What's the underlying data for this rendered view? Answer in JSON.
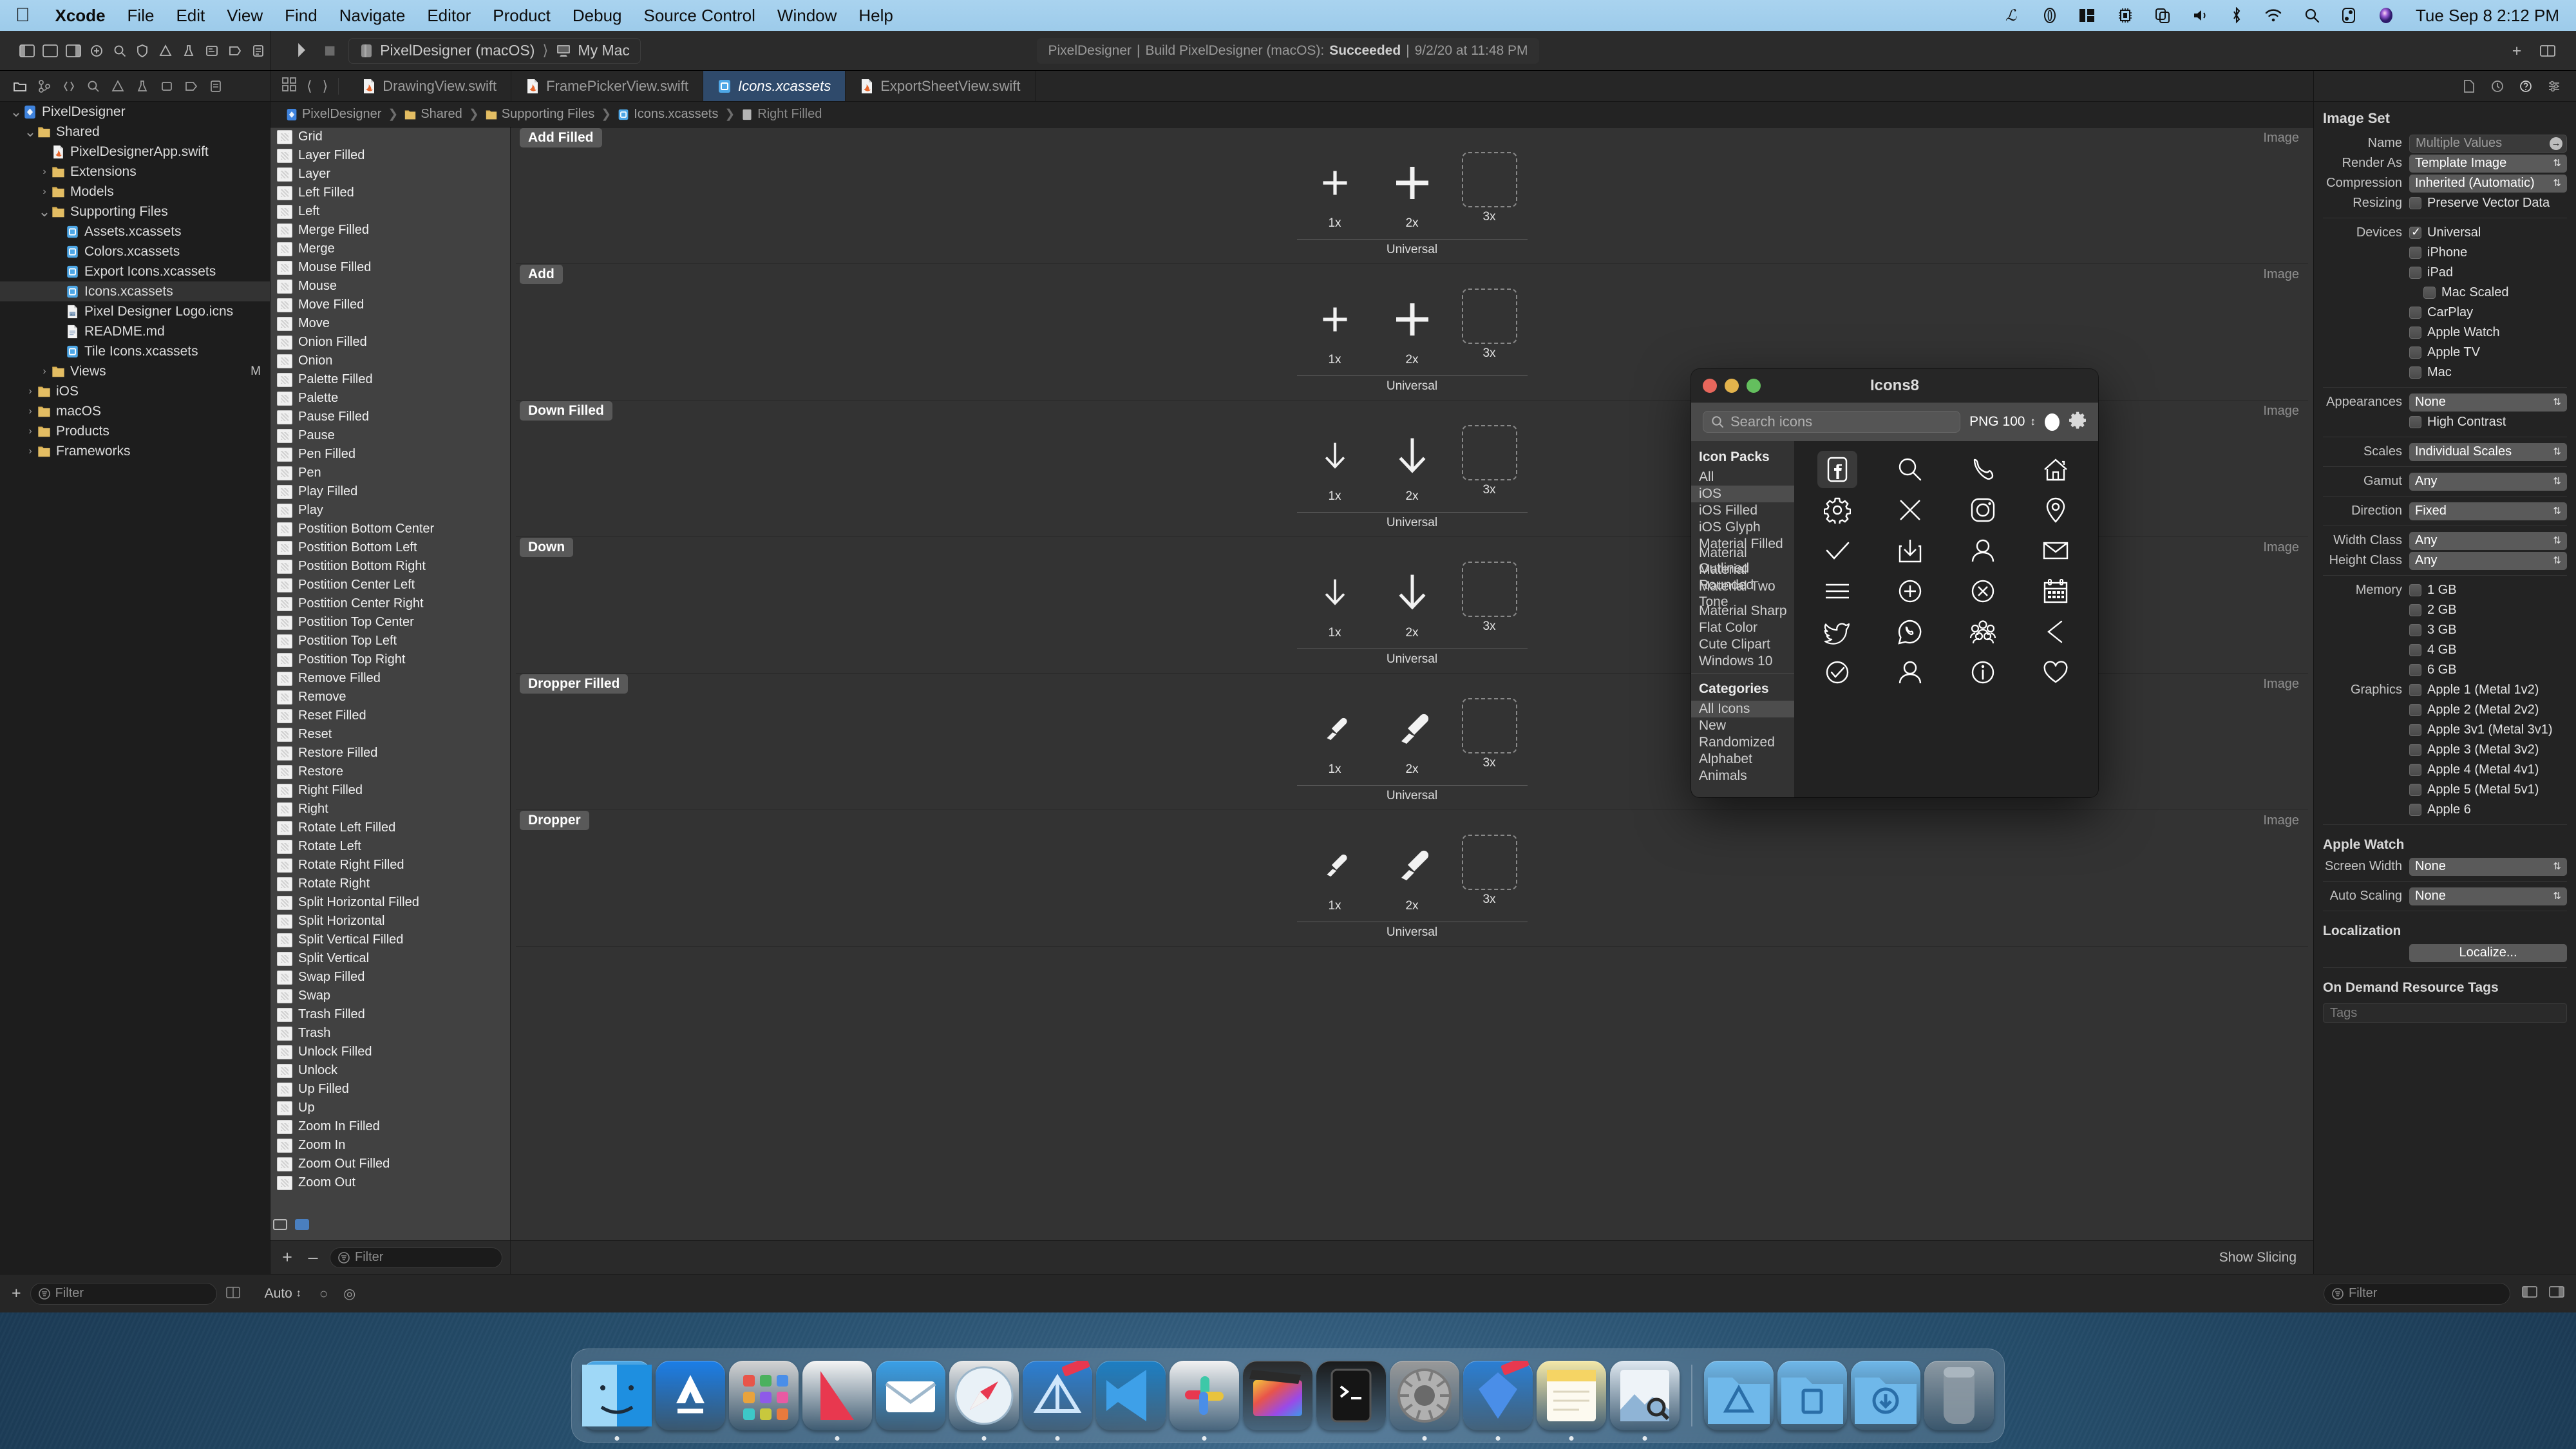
{
  "menubar": {
    "apple": "apple-logo",
    "items": [
      "Xcode",
      "File",
      "Edit",
      "View",
      "Find",
      "Navigate",
      "Editor",
      "Product",
      "Debug",
      "Source Control",
      "Window",
      "Help"
    ],
    "status_icons": [
      "grammarly-icon",
      "capsule-icon",
      "sidebar-icon",
      "cpu-icon",
      "copy-icon",
      "volume-icon",
      "bluetooth-icon",
      "wifi-icon",
      "search-icon",
      "control-center-icon",
      "siri-icon"
    ],
    "clock": "Tue Sep 8  2:12 PM"
  },
  "toolbar": {
    "scheme_project": "PixelDesigner (macOS)",
    "scheme_device": "My Mac",
    "activity": {
      "project": "PixelDesigner",
      "action": "Build PixelDesigner (macOS):",
      "result": "Succeeded",
      "timestamp": "9/2/20 at 11:48 PM"
    }
  },
  "tabs": [
    {
      "label": "DrawingView.swift",
      "icon": "swift-file-icon",
      "active": false
    },
    {
      "label": "FramePickerView.swift",
      "icon": "swift-file-icon",
      "active": false
    },
    {
      "label": "Icons.xcassets",
      "icon": "xcassets-icon",
      "active": true
    },
    {
      "label": "ExportSheetView.swift",
      "icon": "swift-file-icon",
      "active": false
    }
  ],
  "breadcrumb": [
    {
      "label": "PixelDesigner",
      "icon": "project-icon"
    },
    {
      "label": "Shared",
      "icon": "folder-icon"
    },
    {
      "label": "Supporting Files",
      "icon": "folder-icon"
    },
    {
      "label": "Icons.xcassets",
      "icon": "xcassets-icon"
    },
    {
      "label": "Right Filled",
      "icon": "imageset-icon"
    }
  ],
  "navigator": {
    "items": [
      {
        "label": "PixelDesigner",
        "indent": 0,
        "twisty": "down",
        "icon": "project-icon",
        "selected": false,
        "modified": ""
      },
      {
        "label": "Shared",
        "indent": 1,
        "twisty": "down",
        "icon": "folder-icon",
        "selected": false,
        "modified": ""
      },
      {
        "label": "PixelDesignerApp.swift",
        "indent": 2,
        "twisty": "",
        "icon": "swift-file-icon",
        "selected": false,
        "modified": ""
      },
      {
        "label": "Extensions",
        "indent": 2,
        "twisty": "right",
        "icon": "folder-icon",
        "selected": false,
        "modified": ""
      },
      {
        "label": "Models",
        "indent": 2,
        "twisty": "right",
        "icon": "folder-icon",
        "selected": false,
        "modified": ""
      },
      {
        "label": "Supporting Files",
        "indent": 2,
        "twisty": "down",
        "icon": "folder-icon",
        "selected": false,
        "modified": ""
      },
      {
        "label": "Assets.xcassets",
        "indent": 3,
        "twisty": "",
        "icon": "xcassets-icon",
        "selected": false,
        "modified": ""
      },
      {
        "label": "Colors.xcassets",
        "indent": 3,
        "twisty": "",
        "icon": "xcassets-icon",
        "selected": false,
        "modified": ""
      },
      {
        "label": "Export Icons.xcassets",
        "indent": 3,
        "twisty": "",
        "icon": "xcassets-icon",
        "selected": false,
        "modified": ""
      },
      {
        "label": "Icons.xcassets",
        "indent": 3,
        "twisty": "",
        "icon": "xcassets-icon",
        "selected": true,
        "modified": ""
      },
      {
        "label": "Pixel Designer Logo.icns",
        "indent": 3,
        "twisty": "",
        "icon": "icns-icon",
        "selected": false,
        "modified": ""
      },
      {
        "label": "README.md",
        "indent": 3,
        "twisty": "",
        "icon": "markdown-icon",
        "selected": false,
        "modified": ""
      },
      {
        "label": "Tile Icons.xcassets",
        "indent": 3,
        "twisty": "",
        "icon": "xcassets-icon",
        "selected": false,
        "modified": ""
      },
      {
        "label": "Views",
        "indent": 2,
        "twisty": "right",
        "icon": "folder-icon",
        "selected": false,
        "modified": "M"
      },
      {
        "label": "iOS",
        "indent": 1,
        "twisty": "right",
        "icon": "folder-icon",
        "selected": false,
        "modified": ""
      },
      {
        "label": "macOS",
        "indent": 1,
        "twisty": "right",
        "icon": "folder-icon",
        "selected": false,
        "modified": ""
      },
      {
        "label": "Products",
        "indent": 1,
        "twisty": "right",
        "icon": "folder-icon",
        "selected": false,
        "modified": ""
      },
      {
        "label": "Frameworks",
        "indent": 1,
        "twisty": "right",
        "icon": "folder-icon",
        "selected": false,
        "modified": ""
      }
    ],
    "filter_placeholder": "Filter"
  },
  "asset_list": {
    "items": [
      "Grid",
      "Layer Filled",
      "Layer",
      "Left Filled",
      "Left",
      "Merge Filled",
      "Merge",
      "Mouse Filled",
      "Mouse",
      "Move Filled",
      "Move",
      "Onion Filled",
      "Onion",
      "Palette Filled",
      "Palette",
      "Pause Filled",
      "Pause",
      "Pen Filled",
      "Pen",
      "Play Filled",
      "Play",
      "Postition Bottom Center",
      "Postition Bottom Left",
      "Postition Bottom Right",
      "Postition Center Left",
      "Postition Center Right",
      "Postition Top Center",
      "Postition Top Left",
      "Postition Top Right",
      "Remove Filled",
      "Remove",
      "Reset Filled",
      "Reset",
      "Restore Filled",
      "Restore",
      "Right Filled",
      "Right",
      "Rotate Left Filled",
      "Rotate Left",
      "Rotate Right Filled",
      "Rotate Right",
      "Split Horizontal Filled",
      "Split Horizontal",
      "Split Vertical Filled",
      "Split Vertical",
      "Swap Filled",
      "Swap",
      "Trash Filled",
      "Trash",
      "Unlock Filled",
      "Unlock",
      "Up Filled",
      "Up",
      "Zoom In Filled",
      "Zoom In",
      "Zoom Out Filled",
      "Zoom Out"
    ],
    "add_button": "+",
    "remove_button": "–",
    "filter_placeholder": "Filter"
  },
  "editor": {
    "slot_labels": [
      "1x",
      "2x",
      "3x"
    ],
    "footer_label": "Universal",
    "type_label": "Image",
    "show_slicing": "Show Slicing",
    "assets": [
      {
        "name": "Add Filled",
        "slots": [
          "plus-small",
          "plus-large",
          "empty"
        ]
      },
      {
        "name": "Add",
        "slots": [
          "plus-small",
          "plus-large",
          "empty"
        ]
      },
      {
        "name": "Down Filled",
        "slots": [
          "arrow-down-small",
          "arrow-down-large",
          "empty"
        ]
      },
      {
        "name": "Down",
        "slots": [
          "arrow-down-small",
          "arrow-down-large",
          "empty"
        ]
      },
      {
        "name": "Dropper Filled",
        "slots": [
          "dropper-small",
          "dropper-large",
          "empty"
        ]
      },
      {
        "name": "Dropper",
        "slots": [
          "dropper-small",
          "dropper-large",
          "empty"
        ]
      }
    ]
  },
  "inspector": {
    "title": "Image Set",
    "name_label": "Name",
    "name_value": "Multiple Values",
    "render_as_label": "Render As",
    "render_as_value": "Template Image",
    "compression_label": "Compression",
    "compression_value": "Inherited (Automatic)",
    "resizing_label": "Resizing",
    "resizing_option": "Preserve Vector Data",
    "devices_label": "Devices",
    "devices": [
      {
        "label": "Universal",
        "checked": true,
        "indent": 0
      },
      {
        "label": "iPhone",
        "checked": false,
        "indent": 0
      },
      {
        "label": "iPad",
        "checked": false,
        "indent": 0
      },
      {
        "label": "Mac Scaled",
        "checked": false,
        "indent": 1
      },
      {
        "label": "CarPlay",
        "checked": false,
        "indent": 0
      },
      {
        "label": "Apple Watch",
        "checked": false,
        "indent": 0
      },
      {
        "label": "Apple TV",
        "checked": false,
        "indent": 0
      },
      {
        "label": "Mac",
        "checked": false,
        "indent": 0
      }
    ],
    "appearances_label": "Appearances",
    "appearances_value": "None",
    "high_contrast": "High Contrast",
    "scales_label": "Scales",
    "scales_value": "Individual Scales",
    "gamut_label": "Gamut",
    "gamut_value": "Any",
    "direction_label": "Direction",
    "direction_value": "Fixed",
    "width_class_label": "Width Class",
    "width_class_value": "Any",
    "height_class_label": "Height Class",
    "height_class_value": "Any",
    "memory_label": "Memory",
    "memory": [
      "1 GB",
      "2 GB",
      "3 GB",
      "4 GB",
      "6 GB"
    ],
    "graphics_label": "Graphics",
    "graphics": [
      "Apple 1 (Metal 1v2)",
      "Apple 2 (Metal 2v2)",
      "Apple 3v1 (Metal 3v1)",
      "Apple 3 (Metal 3v2)",
      "Apple 4 (Metal 4v1)",
      "Apple 5 (Metal 5v1)",
      "Apple 6"
    ],
    "apple_watch_header": "Apple Watch",
    "screen_width_label": "Screen Width",
    "screen_width_value": "None",
    "auto_scaling_label": "Auto Scaling",
    "auto_scaling_value": "None",
    "localization_header": "Localization",
    "localize_button": "Localize...",
    "odr_header": "On Demand Resource Tags",
    "tags_placeholder": "Tags"
  },
  "status_bar": {
    "auto_label": "Auto",
    "filter_placeholder": "Filter"
  },
  "icons8": {
    "window_title": "Icons8",
    "search_placeholder": "Search icons",
    "format": "PNG 100",
    "color_swatch": "#ffffff",
    "settings_icon": "gear-icon",
    "packs_header": "Icon Packs",
    "packs": [
      {
        "label": "All",
        "selected": false
      },
      {
        "label": "iOS",
        "selected": true
      },
      {
        "label": "iOS Filled",
        "selected": false
      },
      {
        "label": "iOS Glyph",
        "selected": false
      },
      {
        "label": "Material Filled",
        "selected": false
      },
      {
        "label": "Material Outlined",
        "selected": false
      },
      {
        "label": "Material Rounded",
        "selected": false
      },
      {
        "label": "Material Two Tone",
        "selected": false
      },
      {
        "label": "Material Sharp",
        "selected": false
      },
      {
        "label": "Flat Color",
        "selected": false
      },
      {
        "label": "Cute Clipart",
        "selected": false
      },
      {
        "label": "Windows 10",
        "selected": false
      }
    ],
    "categories_header": "Categories",
    "categories": [
      {
        "label": "All Icons",
        "selected": true
      },
      {
        "label": "New",
        "selected": false
      },
      {
        "label": "Randomized",
        "selected": false
      },
      {
        "label": "Alphabet",
        "selected": false
      },
      {
        "label": "Animals",
        "selected": false
      }
    ],
    "grid_icons": [
      {
        "name": "facebook-icon",
        "selected": true
      },
      {
        "name": "search-icon",
        "selected": false
      },
      {
        "name": "phone-icon",
        "selected": false
      },
      {
        "name": "home-icon",
        "selected": false
      },
      {
        "name": "gear-icon",
        "selected": false
      },
      {
        "name": "close-x-icon",
        "selected": false
      },
      {
        "name": "instagram-icon",
        "selected": false
      },
      {
        "name": "map-marker-icon",
        "selected": false
      },
      {
        "name": "checkmark-icon",
        "selected": false
      },
      {
        "name": "download-icon",
        "selected": false
      },
      {
        "name": "user-icon",
        "selected": false
      },
      {
        "name": "envelope-icon",
        "selected": false
      },
      {
        "name": "menu-hamburger-icon",
        "selected": false
      },
      {
        "name": "plus-circle-icon",
        "selected": false
      },
      {
        "name": "close-circle-icon",
        "selected": false
      },
      {
        "name": "calendar-icon",
        "selected": false
      },
      {
        "name": "twitter-icon",
        "selected": false
      },
      {
        "name": "whatsapp-icon",
        "selected": false
      },
      {
        "name": "group-icon",
        "selected": false
      },
      {
        "name": "chevron-left-icon",
        "selected": false
      },
      {
        "name": "check-circle-icon",
        "selected": false
      },
      {
        "name": "user-filled-icon",
        "selected": false
      },
      {
        "name": "info-circle-icon",
        "selected": false
      },
      {
        "name": "heart-icon",
        "selected": false
      }
    ]
  },
  "dock": {
    "items": [
      {
        "name": "finder",
        "color": "#4aa8e8"
      },
      {
        "name": "app-store",
        "color": "#1b7ee8"
      },
      {
        "name": "launchpad",
        "color": "#d3d3d3"
      },
      {
        "name": "news",
        "color": "#f5f5f5"
      },
      {
        "name": "mail",
        "color": "#3aa0e8"
      },
      {
        "name": "safari",
        "color": "#e8e8e8"
      },
      {
        "name": "xcode-beta",
        "color": "#2b7fd4"
      },
      {
        "name": "vscode",
        "color": "#1d7fc4"
      },
      {
        "name": "slack",
        "color": "#f2f2f2"
      },
      {
        "name": "final-cut-pro",
        "color": "#2a2a2a"
      },
      {
        "name": "iterm",
        "color": "#1a1a1a"
      },
      {
        "name": "system-preferences",
        "color": "#9a9a9a"
      },
      {
        "name": "sketch-beta",
        "color": "#2b7fd4"
      },
      {
        "name": "notes",
        "color": "#f5e9a8"
      },
      {
        "name": "preview",
        "color": "#dfe8f0"
      }
    ],
    "folders": [
      {
        "name": "applications-folder",
        "color": "#6fb8ea"
      },
      {
        "name": "documents-folder",
        "color": "#6fb8ea"
      },
      {
        "name": "downloads-folder",
        "color": "#6fb8ea"
      }
    ],
    "trash": {
      "name": "trash",
      "color": "#8d9aa4"
    }
  }
}
